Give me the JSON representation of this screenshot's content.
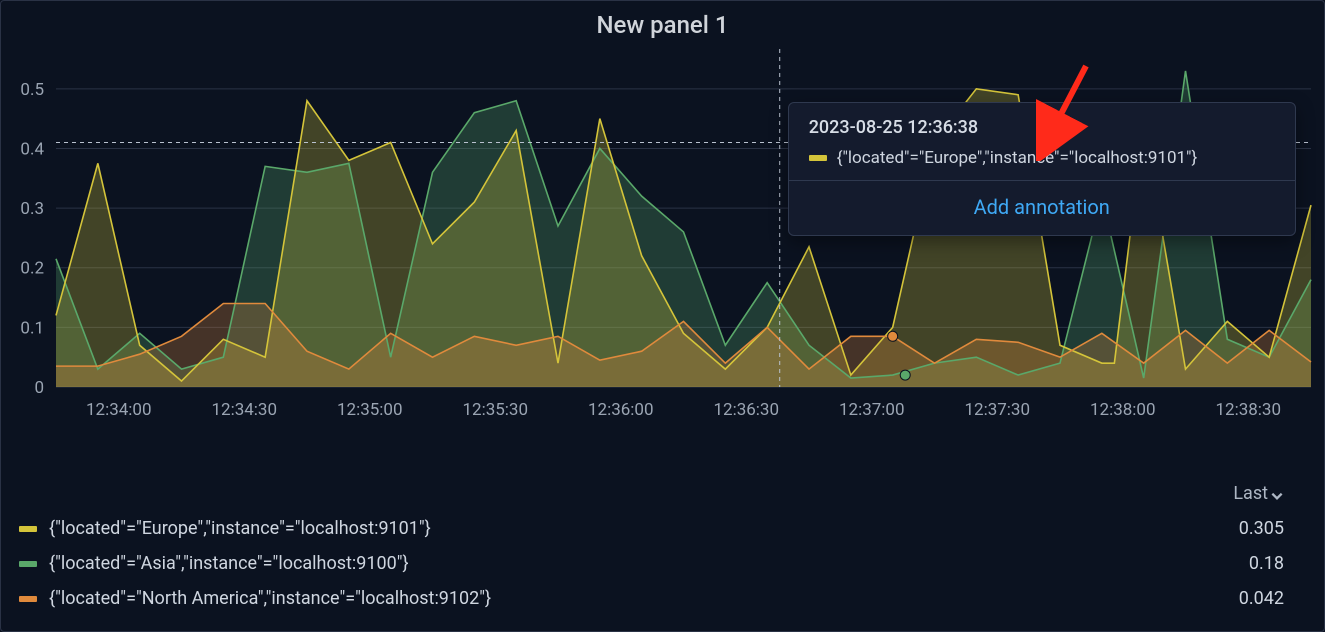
{
  "title": "New panel 1",
  "chart_data": {
    "type": "line",
    "xlabel": "",
    "ylabel": "",
    "ylim": [
      0,
      0.55
    ],
    "y_ticks": [
      0,
      0.1,
      0.2,
      0.3,
      0.4,
      0.5
    ],
    "x_tick_labels": [
      "12:34:00",
      "12:34:30",
      "12:35:00",
      "12:35:30",
      "12:36:00",
      "12:36:30",
      "12:37:00",
      "12:37:30",
      "12:38:00",
      "12:38:30"
    ],
    "x_start_sec": 0,
    "x_end_sec": 300,
    "x_tick_positions_sec": [
      15,
      45,
      75,
      105,
      135,
      165,
      195,
      225,
      255,
      285
    ],
    "grid_on": true,
    "series": [
      {
        "name": "{\"located\"=\"Europe\",\"instance\"=\"localhost:9101\"}",
        "color": "#d4c43a",
        "x_sec": [
          0,
          10,
          20,
          30,
          40,
          50,
          60,
          70,
          80,
          90,
          100,
          110,
          120,
          130,
          140,
          150,
          160,
          170,
          180,
          190,
          200,
          210,
          220,
          230,
          240,
          250,
          253,
          260,
          270,
          280,
          290,
          300
        ],
        "values": [
          0.12,
          0.375,
          0.07,
          0.01,
          0.08,
          0.05,
          0.48,
          0.38,
          0.41,
          0.24,
          0.31,
          0.43,
          0.04,
          0.45,
          0.22,
          0.09,
          0.03,
          0.1,
          0.235,
          0.02,
          0.1,
          0.41,
          0.5,
          0.49,
          0.07,
          0.04,
          0.04,
          0.44,
          0.03,
          0.11,
          0.05,
          0.305
        ]
      },
      {
        "name": "{\"located\"=\"Asia\",\"instance\"=\"localhost:9100\"}",
        "color": "#5aa86a",
        "x_sec": [
          0,
          10,
          20,
          30,
          40,
          50,
          60,
          70,
          80,
          90,
          100,
          110,
          120,
          130,
          140,
          150,
          160,
          170,
          180,
          190,
          200,
          210,
          220,
          230,
          240,
          250,
          260,
          270,
          280,
          290,
          300
        ],
        "values": [
          0.215,
          0.03,
          0.09,
          0.03,
          0.05,
          0.37,
          0.36,
          0.375,
          0.05,
          0.36,
          0.46,
          0.48,
          0.27,
          0.4,
          0.32,
          0.26,
          0.07,
          0.175,
          0.07,
          0.015,
          0.02,
          0.04,
          0.05,
          0.02,
          0.04,
          0.32,
          0.015,
          0.53,
          0.08,
          0.05,
          0.18
        ]
      },
      {
        "name": "{\"located\"=\"North America\",\"instance\"=\"localhost:9102\"}",
        "color": "#e08a3c",
        "x_sec": [
          0,
          10,
          20,
          30,
          40,
          50,
          60,
          70,
          80,
          90,
          100,
          110,
          120,
          130,
          140,
          150,
          160,
          170,
          180,
          190,
          200,
          210,
          220,
          230,
          240,
          250,
          260,
          270,
          280,
          290,
          300
        ],
        "values": [
          0.035,
          0.035,
          0.055,
          0.085,
          0.14,
          0.14,
          0.06,
          0.03,
          0.09,
          0.05,
          0.085,
          0.07,
          0.085,
          0.045,
          0.06,
          0.11,
          0.04,
          0.1,
          0.03,
          0.085,
          0.085,
          0.04,
          0.08,
          0.075,
          0.05,
          0.09,
          0.04,
          0.095,
          0.04,
          0.095,
          0.042
        ]
      }
    ]
  },
  "crosshair": {
    "x_sec": 173,
    "y_value": 0.41
  },
  "hover_markers": [
    {
      "series": 2,
      "x_sec": 200,
      "y_value": 0.085
    },
    {
      "series": 1,
      "x_sec": 203,
      "y_value": 0.02
    }
  ],
  "tooltip": {
    "timestamp": "2023-08-25 12:36:38",
    "rows": [
      {
        "color": "#d4c43a",
        "label": "{\"located\"=\"Europe\",\"instance\"=\"localhost:9101\"}"
      }
    ],
    "action_label": "Add annotation"
  },
  "legend": {
    "column_label": "Last",
    "rows": [
      {
        "series": 0,
        "value": "0.305"
      },
      {
        "series": 1,
        "value": "0.18"
      },
      {
        "series": 2,
        "value": "0.042"
      }
    ]
  },
  "arrow": {
    "present": true
  }
}
